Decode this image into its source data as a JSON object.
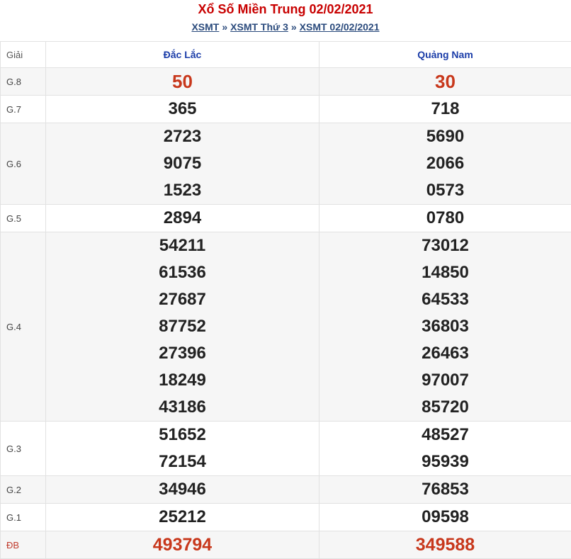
{
  "title": "Xổ Số Miền Trung 02/02/2021",
  "breadcrumb": {
    "items": [
      "XSMT",
      "XSMT Thứ 3",
      "XSMT 02/02/2021"
    ],
    "separator": "»"
  },
  "table": {
    "giai_header": "Giải",
    "provinces": [
      "Đắc Lắc",
      "Quảng Nam"
    ],
    "rows": [
      {
        "label": "G.8",
        "col1": [
          "50"
        ],
        "col2": [
          "30"
        ]
      },
      {
        "label": "G.7",
        "col1": [
          "365"
        ],
        "col2": [
          "718"
        ]
      },
      {
        "label": "G.6",
        "col1": [
          "2723",
          "9075",
          "1523"
        ],
        "col2": [
          "5690",
          "2066",
          "0573"
        ]
      },
      {
        "label": "G.5",
        "col1": [
          "2894"
        ],
        "col2": [
          "0780"
        ]
      },
      {
        "label": "G.4",
        "col1": [
          "54211",
          "61536",
          "27687",
          "87752",
          "27396",
          "18249",
          "43186"
        ],
        "col2": [
          "73012",
          "14850",
          "64533",
          "36803",
          "26463",
          "97007",
          "85720"
        ]
      },
      {
        "label": "G.3",
        "col1": [
          "51652",
          "72154"
        ],
        "col2": [
          "48527",
          "95939"
        ]
      },
      {
        "label": "G.2",
        "col1": [
          "34946"
        ],
        "col2": [
          "76853"
        ]
      },
      {
        "label": "G.1",
        "col1": [
          "25212"
        ],
        "col2": [
          "09598"
        ]
      },
      {
        "label": "ĐB",
        "col1": [
          "493794"
        ],
        "col2": [
          "349588"
        ]
      }
    ]
  },
  "colors": {
    "title": "#c80000",
    "special": "#c8381c",
    "header": "#1a3ca8",
    "link": "#2a4a7c"
  }
}
